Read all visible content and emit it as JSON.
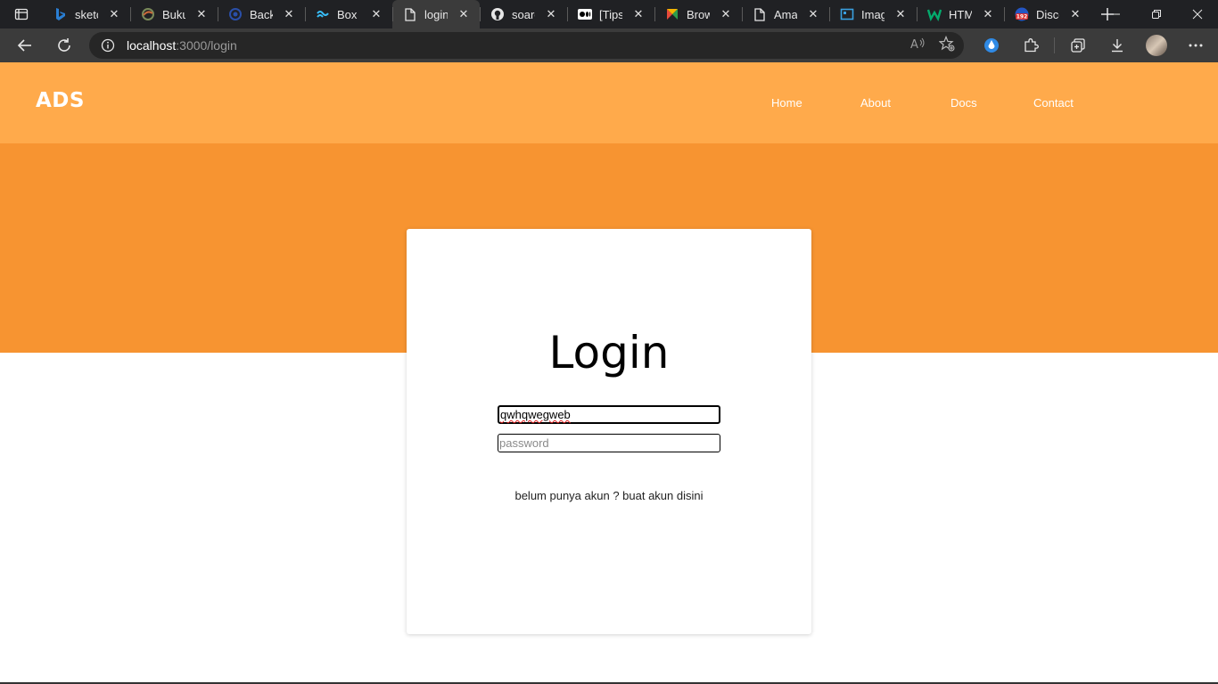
{
  "browser": {
    "tabs": [
      {
        "title": "sketch",
        "icon": "bing-icon",
        "active": false
      },
      {
        "title": "Buku",
        "icon": "swirl-icon",
        "active": false
      },
      {
        "title": "Backend",
        "icon": "edge-logo-icon",
        "active": false
      },
      {
        "title": "Box S",
        "icon": "tailwind-icon",
        "active": false
      },
      {
        "title": "login",
        "icon": "page-icon",
        "active": true
      },
      {
        "title": "soarc",
        "icon": "github-icon",
        "active": false
      },
      {
        "title": "[Tips",
        "icon": "medium-icon",
        "active": false
      },
      {
        "title": "Brow",
        "icon": "colorful-logo-icon",
        "active": false
      },
      {
        "title": "Ama",
        "icon": "page-icon",
        "active": false
      },
      {
        "title": "Imag",
        "icon": "image-frame-icon",
        "active": false
      },
      {
        "title": "HTM",
        "icon": "w3-icon",
        "active": false
      },
      {
        "title": "Disco",
        "icon": "badge-192-icon",
        "active": false
      }
    ],
    "badge_number": "192",
    "address": {
      "host": "localhost",
      "path": ":3000/login"
    }
  },
  "site": {
    "brand": "ADS",
    "nav": [
      "Home",
      "About",
      "Docs",
      "Contact"
    ],
    "colors": {
      "navbar": "#ffaa4b",
      "hero": "#f79431"
    }
  },
  "login": {
    "title": "Login",
    "username_value": "qwhqwegweb",
    "password_placeholder": "password",
    "signup_text": "belum punya akun ? buat akun disini"
  }
}
